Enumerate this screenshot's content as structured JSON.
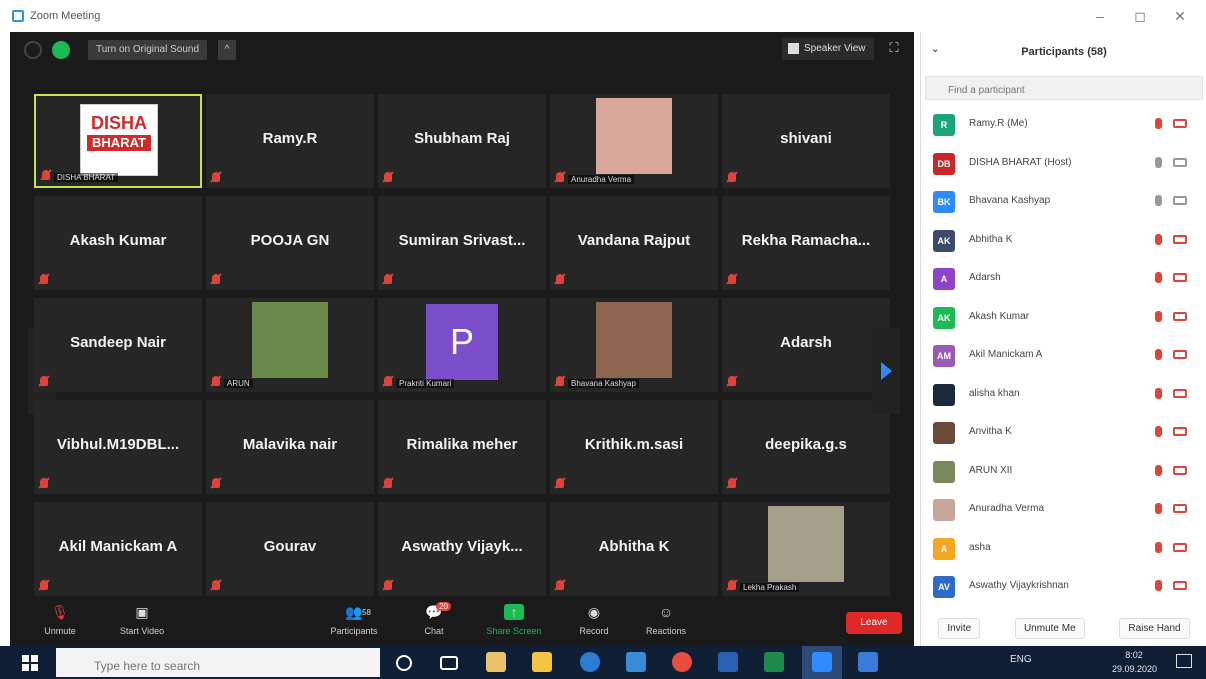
{
  "window": {
    "title": "Zoom Meeting",
    "controls": [
      "–",
      "◻",
      "✕"
    ]
  },
  "topbar": {
    "original_sound": "Turn on Original Sound",
    "caret": "^",
    "speaker_view": "Speaker View",
    "fullscreen": "⛶"
  },
  "tiles": [
    {
      "name": "",
      "label": "DISHA BHARAT",
      "type": "logo",
      "logo_line1": "DISHA",
      "logo_line2": "BHARAT",
      "active": true
    },
    {
      "name": "Ramy.R",
      "type": "text"
    },
    {
      "name": "Shubham Raj",
      "type": "text"
    },
    {
      "name": "",
      "label": "Anuradha Verma",
      "type": "photo",
      "photo_color": "#d9a89a"
    },
    {
      "name": "shivani",
      "type": "text"
    },
    {
      "name": "Akash Kumar",
      "type": "text"
    },
    {
      "name": "POOJA GN",
      "type": "text"
    },
    {
      "name": "Sumiran  Srivast...",
      "type": "text"
    },
    {
      "name": "Vandana Rajput",
      "type": "text"
    },
    {
      "name": "Rekha  Ramacha...",
      "type": "text"
    },
    {
      "name": "Sandeep Nair",
      "type": "text"
    },
    {
      "name": "",
      "label": "ARUN",
      "type": "photo",
      "photo_color": "#6a8a4a"
    },
    {
      "name": "",
      "label": "Prakriti Kumari",
      "type": "avatar",
      "avatar_letter": "P"
    },
    {
      "name": "",
      "label": "Bhavana Kashyap",
      "type": "photo",
      "photo_color": "#8c6450"
    },
    {
      "name": "Adarsh",
      "type": "text"
    },
    {
      "name": "Vibhul.M19DBL...",
      "type": "text"
    },
    {
      "name": "Malavika nair",
      "type": "text"
    },
    {
      "name": "Rimalika meher",
      "type": "text"
    },
    {
      "name": "Krithik.m.sasi",
      "type": "text"
    },
    {
      "name": "deepika.g.s",
      "type": "text"
    },
    {
      "name": "Akil Manickam A",
      "type": "text"
    },
    {
      "name": "Gourav",
      "type": "text"
    },
    {
      "name": "Aswathy  Vijayk...",
      "type": "text"
    },
    {
      "name": "Abhitha K",
      "type": "text"
    },
    {
      "name": "",
      "label": "Lekha Prakash",
      "type": "photo",
      "photo_color": "#a5a08a"
    }
  ],
  "toolbar": {
    "unmute": "Unmute",
    "start_video": "Start Video",
    "participants": "Participants",
    "participants_count": "58",
    "chat": "Chat",
    "chat_badge": "20",
    "share_screen": "Share Screen",
    "record": "Record",
    "reactions": "Reactions",
    "leave": "Leave"
  },
  "panel": {
    "title": "Participants (58)",
    "collapse": "⌄",
    "search_placeholder": "Find a participant",
    "participants": [
      {
        "initials": "R",
        "name": "Ramy.R (Me)",
        "color": "#1aa67a",
        "mic_on": false,
        "video_on": false
      },
      {
        "initials": "DB",
        "name": "DISHA BHARAT (Host)",
        "color": "#c8262a",
        "mic_on": true,
        "video_on": true
      },
      {
        "initials": "BK",
        "name": "Bhavana Kashyap",
        "color": "#2d8cff",
        "mic_on": true,
        "video_on": true
      },
      {
        "initials": "AK",
        "name": "Abhitha K",
        "color": "#3c4a6b",
        "mic_on": false,
        "video_on": false
      },
      {
        "initials": "A",
        "name": "Adarsh",
        "color": "#8e44c9",
        "mic_on": false,
        "video_on": false
      },
      {
        "initials": "AK",
        "name": "Akash Kumar",
        "color": "#1db954",
        "mic_on": false,
        "video_on": false
      },
      {
        "initials": "AM",
        "name": "Akil Manickam A",
        "color": "#9b59b6",
        "mic_on": false,
        "video_on": false
      },
      {
        "initials": "",
        "name": "alisha khan",
        "color": "#1a2a3a",
        "mic_on": false,
        "video_on": false
      },
      {
        "initials": "",
        "name": "Anvitha K",
        "color": "#6b4a3a",
        "mic_on": false,
        "video_on": false
      },
      {
        "initials": "",
        "name": "ARUN XII",
        "color": "#7a8a5a",
        "mic_on": false,
        "video_on": false
      },
      {
        "initials": "",
        "name": "Anuradha Verma",
        "color": "#c9a69a",
        "mic_on": false,
        "video_on": false
      },
      {
        "initials": "A",
        "name": "asha",
        "color": "#f5a623",
        "mic_on": false,
        "video_on": false
      },
      {
        "initials": "AV",
        "name": "Aswathy Vijaykrishnan",
        "color": "#2d6bc8",
        "mic_on": false,
        "video_on": false
      }
    ],
    "invite": "Invite",
    "unmute_me": "Unmute Me",
    "raise_hand": "Raise Hand"
  },
  "taskbar": {
    "search_placeholder": "Type here to search",
    "tray_text": "ENG",
    "time": "8:02",
    "date": "29.09.2020"
  }
}
